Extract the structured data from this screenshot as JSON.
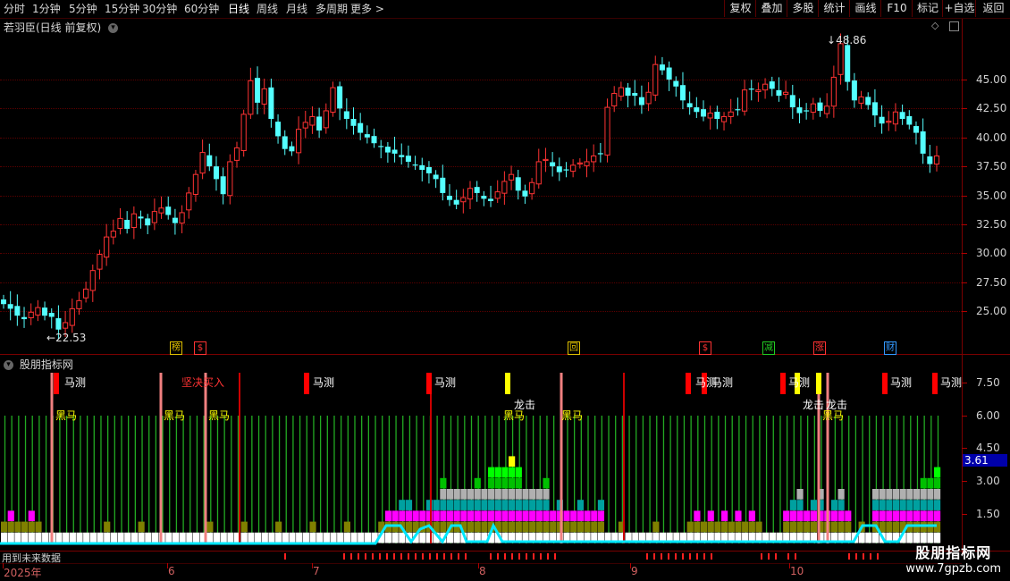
{
  "toolbar": {
    "left": [
      "分时",
      "1分钟",
      "5分钟",
      "15分钟",
      "30分钟",
      "60分钟",
      "日线",
      "周线",
      "月线",
      "多周期",
      "更多 >"
    ],
    "active": "日线",
    "right": [
      "复权",
      "叠加",
      "多股",
      "统计",
      "画线",
      "F10",
      "标记",
      "+自选",
      "返回"
    ]
  },
  "main_chart": {
    "title": "若羽臣(日线 前复权)",
    "high_label": "48.86",
    "low_label": "22.53",
    "y_ticks": [
      "45.00",
      "42.50",
      "40.00",
      "37.50",
      "35.00",
      "32.50",
      "30.00",
      "27.50",
      "25.00"
    ],
    "markers": [
      {
        "text": "榜",
        "color": "#e0c000"
      },
      {
        "text": "$",
        "color": "#ff3333"
      },
      {
        "text": "回",
        "color": "#e0c000"
      },
      {
        "text": "$",
        "color": "#ff3333"
      },
      {
        "text": "减",
        "color": "#22cc22"
      },
      {
        "text": "涨",
        "color": "#ff3333"
      },
      {
        "text": "财",
        "color": "#3399ff"
      }
    ]
  },
  "indicator": {
    "title": "股朋指标网",
    "y_ticks": [
      "7.50",
      "6.00",
      "4.50",
      "3.00",
      "1.50"
    ],
    "current_value": "3.61",
    "labels": {
      "mace": "马测",
      "heima": "黑马",
      "longji": "龙击",
      "jianjue": "坚决买入"
    }
  },
  "bottom": {
    "status_text": "用到未来数据",
    "months": [
      "2025年",
      "6",
      "7",
      "8",
      "9",
      "10"
    ]
  },
  "watermark": {
    "line1": "股朋指标网",
    "line2": "www.7gpzb.com"
  },
  "colors": {
    "up": "#ff3333",
    "down": "#54ffff",
    "border": "#7a0000",
    "accent": "#ff3333"
  },
  "chart_data": {
    "type": "candlestick",
    "series_name": "若羽臣",
    "ylim": [
      22.5,
      48.86
    ],
    "y_ticks": [
      25.0,
      27.5,
      30.0,
      32.5,
      35.0,
      37.5,
      40.0,
      42.5,
      45.0
    ],
    "high": 48.86,
    "low": 22.53,
    "closes": [
      25.6,
      25.2,
      24.6,
      24.3,
      24.9,
      25.3,
      24.6,
      24.5,
      23.4,
      24.0,
      25.2,
      25.9,
      26.9,
      28.5,
      29.9,
      31.4,
      31.9,
      33.0,
      32.1,
      33.4,
      33.0,
      32.4,
      33.6,
      33.9,
      33.3,
      32.6,
      33.5,
      35.2,
      36.8,
      38.7,
      37.5,
      36.4,
      35.1,
      37.9,
      39.1,
      42.0,
      44.9,
      43.0,
      44.2,
      41.6,
      40.1,
      39.0,
      38.8,
      40.7,
      41.3,
      41.8,
      40.6,
      42.3,
      44.3,
      42.5,
      41.6,
      41.0,
      40.4,
      40.0,
      39.5,
      39.2,
      38.7,
      38.6,
      38.3,
      37.9,
      37.6,
      37.2,
      36.9,
      36.4,
      35.2,
      34.6,
      34.2,
      34.8,
      35.6,
      35.2,
      34.7,
      34.5,
      35.3,
      36.2,
      36.8,
      35.4,
      34.9,
      36.1,
      37.9,
      38.1,
      37.5,
      37.0,
      37.2,
      37.6,
      37.8,
      37.9,
      38.4,
      38.6,
      42.6,
      43.8,
      44.3,
      43.6,
      43.6,
      42.8,
      43.9,
      46.3,
      45.8,
      45.0,
      44.4,
      43.2,
      42.6,
      42.2,
      41.8,
      42.1,
      41.6,
      41.8,
      42.2,
      42.4,
      44.1,
      44.2,
      44.1,
      44.6,
      44.2,
      43.6,
      43.9,
      42.6,
      42.1,
      42.3,
      42.9,
      42.3,
      42.7,
      45.2,
      48.1,
      44.8,
      43.2,
      43.5,
      42.8,
      41.9,
      41.2,
      41.4,
      42.2,
      41.6,
      41.1,
      40.4,
      38.6,
      37.7,
      38.4
    ]
  }
}
